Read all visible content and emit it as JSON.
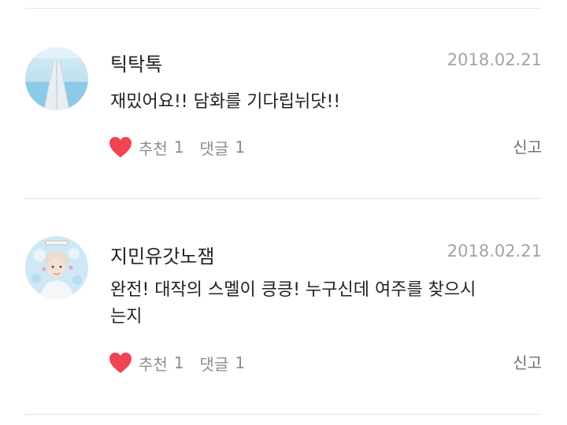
{
  "comments": [
    {
      "nickname": "틱탁톡",
      "date": "2018.02.21",
      "text": "재밌어요!! 담화를 기다립뉘닷!!",
      "recommend_label": "추천",
      "recommend_count": "1",
      "reply_label": "댓글",
      "reply_count": "1",
      "report_label": "신고",
      "avatar_icon": "bridge-photo-icon"
    },
    {
      "nickname": "지민유갓노잼",
      "date": "2018.02.21",
      "text": "완전! 대작의 스멜이 킁킁! 누구신데 여주를 찾으시는지",
      "recommend_label": "추천",
      "recommend_count": "1",
      "reply_label": "댓글",
      "reply_count": "1",
      "report_label": "신고",
      "avatar_icon": "person-photo-icon"
    }
  ],
  "colors": {
    "heart": "#f04452",
    "divider": "#e4e4e4",
    "date": "#a3a3a3",
    "text": "#222222"
  }
}
